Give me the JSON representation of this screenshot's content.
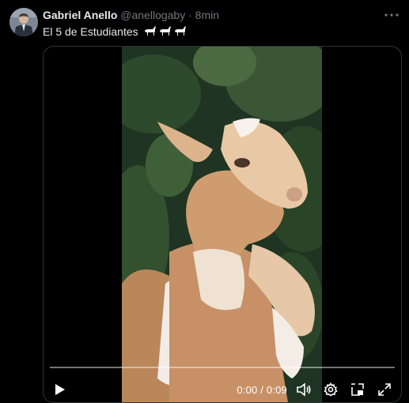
{
  "tweet": {
    "author_name": "Gabriel Anello",
    "handle": "@anellogaby",
    "separator": "·",
    "time": "8min",
    "text": "El 5 de Estudiantes",
    "emoji_icons": [
      "goat-icon",
      "goat-icon",
      "goat-icon"
    ]
  },
  "video": {
    "current_time": "0:00",
    "time_separator": "/",
    "duration": "0:09",
    "progress": 0.0
  },
  "colors": {
    "background": "#000000",
    "text_primary": "#e7e9ea",
    "text_secondary": "#71767b",
    "border": "#2f3336"
  }
}
